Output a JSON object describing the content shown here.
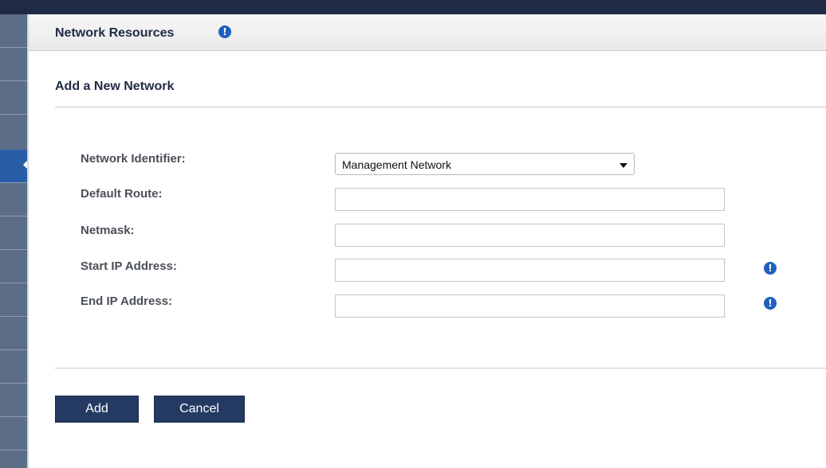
{
  "header": {
    "title": "Network Resources",
    "info_glyph": "!"
  },
  "form": {
    "section_title": "Add a New Network",
    "network_identifier": {
      "label": "Network Identifier:",
      "value": "Management Network"
    },
    "default_route": {
      "label": "Default Route:",
      "value": ""
    },
    "netmask": {
      "label": "Netmask:",
      "value": ""
    },
    "start_ip": {
      "label": "Start IP Address:",
      "value": "",
      "info_glyph": "!"
    },
    "end_ip": {
      "label": "End IP Address:",
      "value": "",
      "info_glyph": "!"
    }
  },
  "actions": {
    "add_label": "Add",
    "cancel_label": "Cancel"
  },
  "icons": {
    "info": "info-icon",
    "dropdown": "chevron-down-icon",
    "nav_pointer": "caret-left-icon"
  },
  "colors": {
    "accent": "#1f5fbf",
    "button": "#243a63",
    "nav": "#5b6e86",
    "topbar": "#1f2a44"
  }
}
